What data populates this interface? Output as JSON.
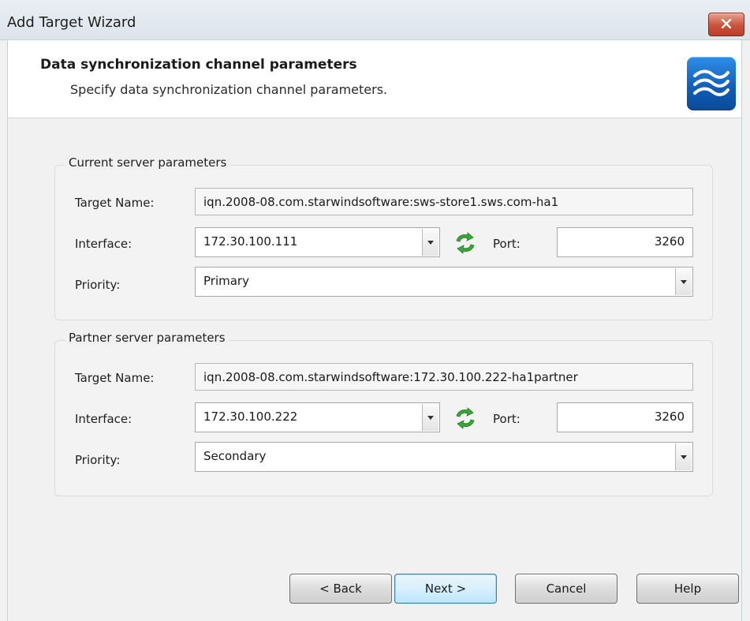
{
  "window": {
    "title": "Add Target Wizard"
  },
  "header": {
    "title": "Data synchronization channel parameters",
    "subtitle": "Specify data synchronization channel parameters."
  },
  "current": {
    "group_label": "Current server parameters",
    "target_name_label": "Target Name:",
    "target_name_value": "iqn.2008-08.com.starwindsoftware:sws-store1.sws.com-ha1",
    "interface_label": "Interface:",
    "interface_value": "172.30.100.111",
    "port_label": "Port:",
    "port_value": "3260",
    "priority_label": "Priority:",
    "priority_value": "Primary"
  },
  "partner": {
    "group_label": "Partner server parameters",
    "target_name_label": "Target Name:",
    "target_name_value": "iqn.2008-08.com.starwindsoftware:172.30.100.222-ha1partner",
    "interface_label": "Interface:",
    "interface_value": "172.30.100.222",
    "port_label": "Port:",
    "port_value": "3260",
    "priority_label": "Priority:",
    "priority_value": "Secondary"
  },
  "buttons": {
    "back": "< Back",
    "next": "Next >",
    "cancel": "Cancel",
    "help": "Help"
  },
  "icons": {
    "close": "close-icon",
    "logo": "starwind-logo-icon",
    "refresh": "refresh-icon",
    "dropdown": "chevron-down-icon"
  },
  "colors": {
    "close_button": "#c9523b",
    "logo_blue": "#0f5cb7",
    "refresh_green": "#3aa63a"
  }
}
